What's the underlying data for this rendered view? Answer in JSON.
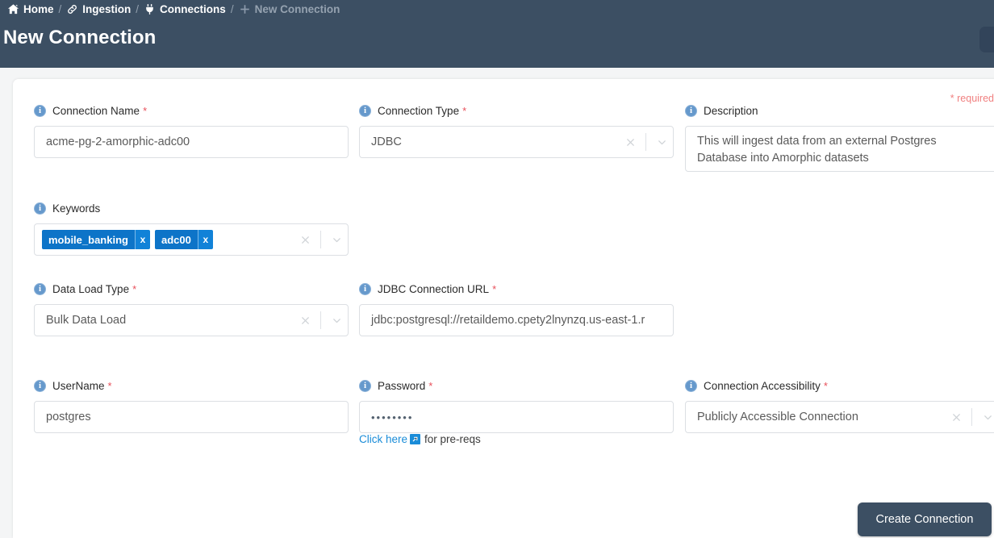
{
  "header": {
    "breadcrumb": [
      {
        "label": "Home",
        "icon": "home-icon",
        "current": false
      },
      {
        "label": "Ingestion",
        "icon": "link-icon",
        "current": false
      },
      {
        "label": "Connections",
        "icon": "plug-icon",
        "current": false
      },
      {
        "label": "New Connection",
        "icon": "plus-icon",
        "current": true
      }
    ],
    "separator": "/",
    "title": "New Connection",
    "background_color": "#3c4f63"
  },
  "form": {
    "required_note": "* required",
    "required_marker": "*",
    "clear_icon": "close-icon",
    "caret_icon": "chevron-down-icon",
    "info_icon": "info-icon",
    "fields": {
      "connection_name": {
        "label": "Connection Name",
        "required": true,
        "value": "acme-pg-2-amorphic-adc00"
      },
      "connection_type": {
        "label": "Connection Type",
        "required": true,
        "value": "JDBC"
      },
      "description": {
        "label": "Description",
        "required": false,
        "value": "This will ingest data from an external Postgres Database into Amorphic datasets"
      },
      "keywords": {
        "label": "Keywords",
        "required": false,
        "tags": [
          "mobile_banking",
          "adc00"
        ],
        "tag_remove_label": "x"
      },
      "data_load_type": {
        "label": "Data Load Type",
        "required": true,
        "value": "Bulk Data Load"
      },
      "jdbc_connection_url": {
        "label": "JDBC Connection URL",
        "required": true,
        "value": "jdbc:postgresql://retaildemo.cpety2lnynzq.us-east-1.r"
      },
      "username": {
        "label": "UserName",
        "required": true,
        "value": "postgres"
      },
      "password": {
        "label": "Password",
        "required": true,
        "value": "••••••••"
      },
      "connection_accessibility": {
        "label": "Connection Accessibility",
        "required": true,
        "value": "Publicly Accessible Connection"
      }
    },
    "helper": {
      "link_text": "Click here",
      "link_icon": "external-link-icon",
      "tail_text": "for pre-reqs"
    },
    "submit_label": "Create Connection"
  },
  "colors": {
    "header_bg": "#3c4f63",
    "tag_blue": "#0d74c8",
    "link_blue": "#1a8cd8",
    "required_red": "#e8505b",
    "required_note": "#f08080",
    "info_blue": "#6699cc"
  }
}
